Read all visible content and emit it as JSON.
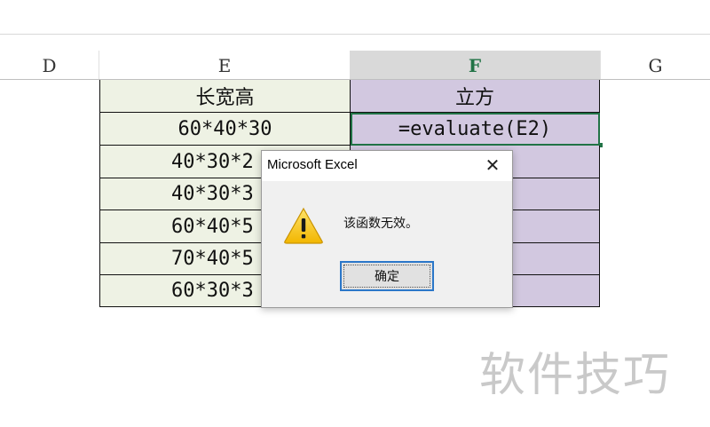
{
  "column_headers": [
    "D",
    "E",
    "F",
    "G"
  ],
  "table": {
    "header_e": "长宽高",
    "header_f": "立方",
    "rows_e": [
      "60*40*30",
      "40*30*2",
      "40*30*3",
      "60*40*5",
      "70*40*5",
      "60*30*3"
    ],
    "formula_f2": "=evaluate(E2)"
  },
  "dialog": {
    "title": "Microsoft Excel",
    "close_glyph": "✕",
    "message": "该函数无效。",
    "ok_label": "确定"
  },
  "watermark": "软件技巧",
  "colors": {
    "selected_header": "#217346",
    "e_fill": "#eef2e4",
    "f_fill": "#d2c8e0"
  }
}
